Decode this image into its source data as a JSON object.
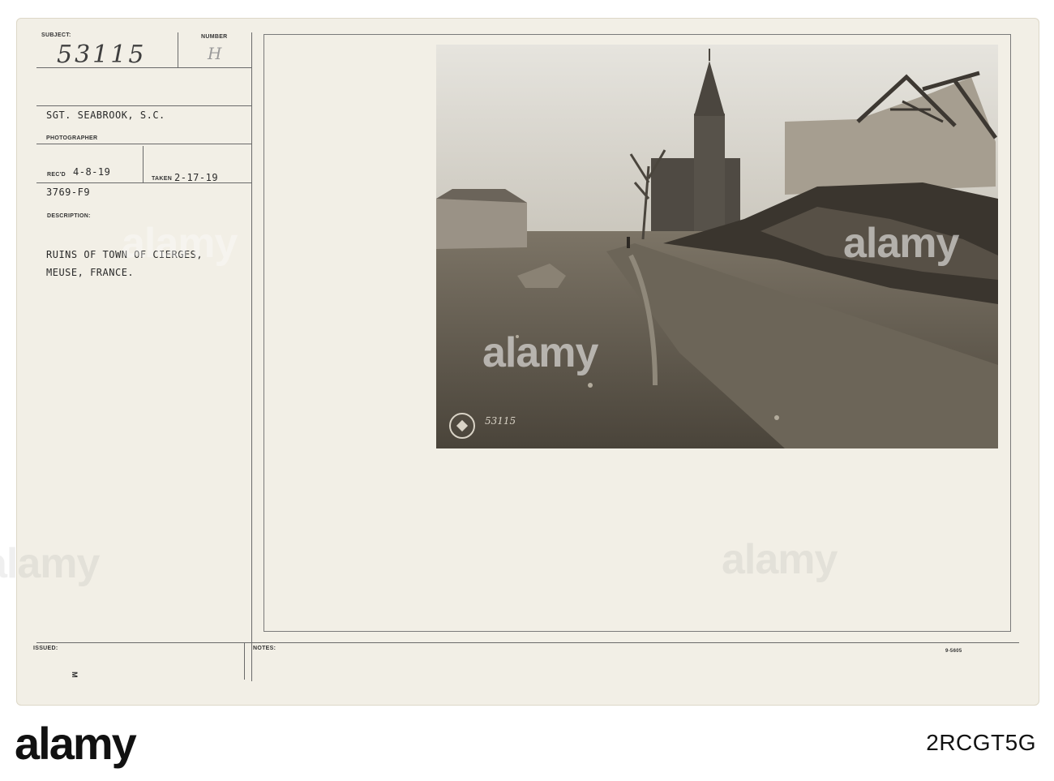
{
  "card": {
    "subject_label": "SUBJECT:",
    "subject_value": "53115",
    "number_label": "NUMBER",
    "number_value": "H",
    "photographer_name": "SGT. SEABROOK, S.C.",
    "photographer_label": "PHOTOGRAPHER",
    "recd_label": "REC'D",
    "recd_value": "4-8-19",
    "taken_label": "TAKEN",
    "taken_value": "2-17-19",
    "reference": "3769-F9",
    "description_label": "DESCRIPTION:",
    "description_line1": "RUINS OF TOWN OF CIERGES,",
    "description_line2": "MEUSE, FRANCE.",
    "issued_label": "ISSUED:",
    "notes_label": "NOTES:",
    "form_number": "9-5605",
    "photo_stamp_number": "53115"
  },
  "colors": {
    "card_background": "#f2efe6",
    "rule_color": "#6a6a6a",
    "photo_sepia": "#5e574c",
    "banner_background": "#ffffff"
  },
  "watermark": {
    "brand": "alamy",
    "stock_id": "2RCGT5G"
  }
}
